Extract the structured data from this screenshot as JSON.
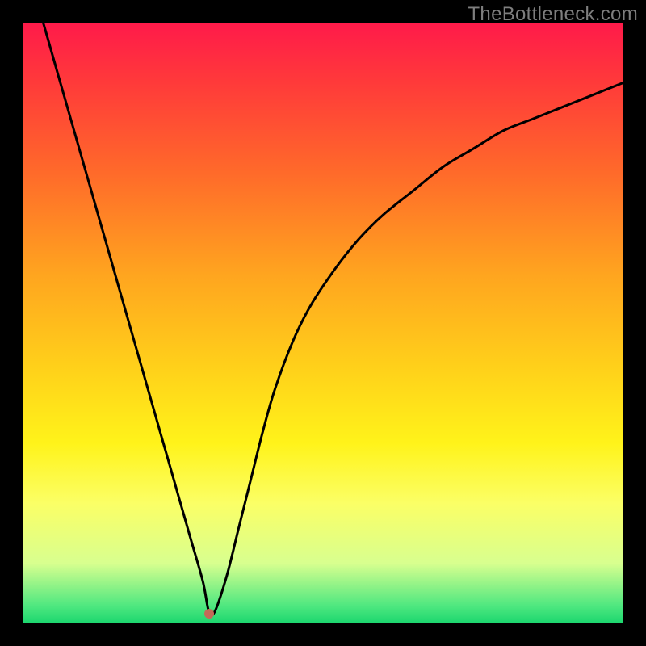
{
  "watermark": "TheBottleneck.com",
  "chart_data": {
    "type": "line",
    "title": "",
    "xlabel": "",
    "ylabel": "",
    "xlim": [
      0,
      100
    ],
    "ylim": [
      0,
      100
    ],
    "grid": false,
    "legend": false,
    "x": [
      0,
      2,
      4,
      6,
      8,
      10,
      12,
      14,
      16,
      18,
      20,
      22,
      24,
      26,
      28,
      30,
      31,
      32,
      34,
      36,
      38,
      40,
      42,
      45,
      48,
      52,
      56,
      60,
      65,
      70,
      75,
      80,
      85,
      90,
      95,
      100
    ],
    "y": [
      113,
      105,
      98,
      91,
      84,
      77,
      70,
      63,
      56,
      49,
      42,
      35,
      28,
      21,
      14,
      7,
      2,
      2,
      8,
      16,
      24,
      32,
      39,
      47,
      53,
      59,
      64,
      68,
      72,
      76,
      79,
      82,
      84,
      86,
      88,
      90
    ],
    "highlight_point": {
      "x": 31,
      "y": 1.6
    }
  },
  "colors": {
    "curve": "#000000",
    "dot": "#c36a58",
    "background_top": "#ff1a4a",
    "background_bottom": "#1bd66e",
    "frame": "#000000"
  }
}
